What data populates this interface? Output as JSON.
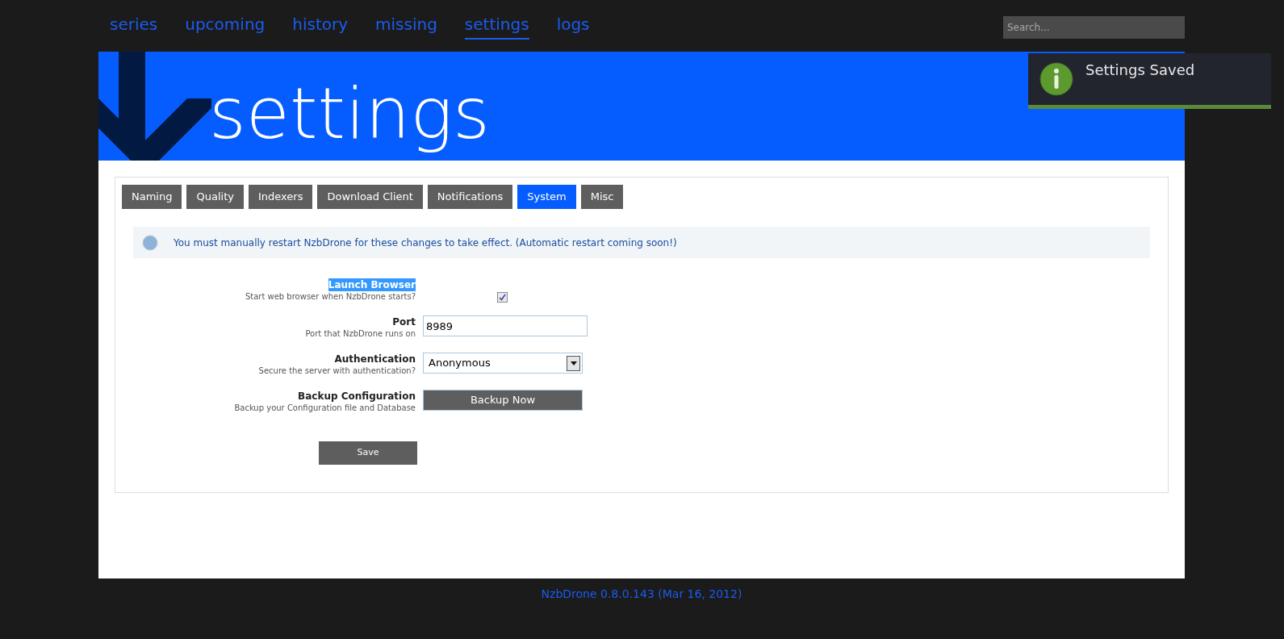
{
  "nav": [
    {
      "label": "series",
      "selected": false
    },
    {
      "label": "upcoming",
      "selected": false
    },
    {
      "label": "history",
      "selected": false
    },
    {
      "label": "missing",
      "selected": false
    },
    {
      "label": "settings",
      "selected": true
    },
    {
      "label": "logs",
      "selected": false
    }
  ],
  "search": {
    "placeholder": "Search..."
  },
  "header": {
    "title": "settings"
  },
  "toast": {
    "message": "Settings Saved"
  },
  "tabs": [
    {
      "label": "Naming",
      "selected": false
    },
    {
      "label": "Quality",
      "selected": false
    },
    {
      "label": "Indexers",
      "selected": false
    },
    {
      "label": "Download Client",
      "selected": false
    },
    {
      "label": "Notifications",
      "selected": false
    },
    {
      "label": "System",
      "selected": true
    },
    {
      "label": "Misc",
      "selected": false
    }
  ],
  "notice": "You must manually restart NzbDrone for these changes to take effect. (Automatic restart coming soon!)",
  "fields": [
    {
      "kind": "checkbox",
      "label": "Launch Browser",
      "highlighted": true,
      "hint": "Start web browser when NzbDrone starts?",
      "checked": true
    },
    {
      "kind": "text",
      "label": "Port",
      "highlighted": false,
      "hint": "Port that NzbDrone runs on",
      "value": "8989"
    },
    {
      "kind": "select",
      "label": "Authentication",
      "highlighted": false,
      "hint": "Secure the server with authentication?",
      "value": "Anonymous"
    },
    {
      "kind": "button",
      "label": "Backup Configuration",
      "highlighted": false,
      "hint": "Backup your Configuration file and Database",
      "value": "Backup Now"
    }
  ],
  "save_button": "Save",
  "footer": "NzbDrone 0.8.0.143 (Mar 16, 2012)"
}
